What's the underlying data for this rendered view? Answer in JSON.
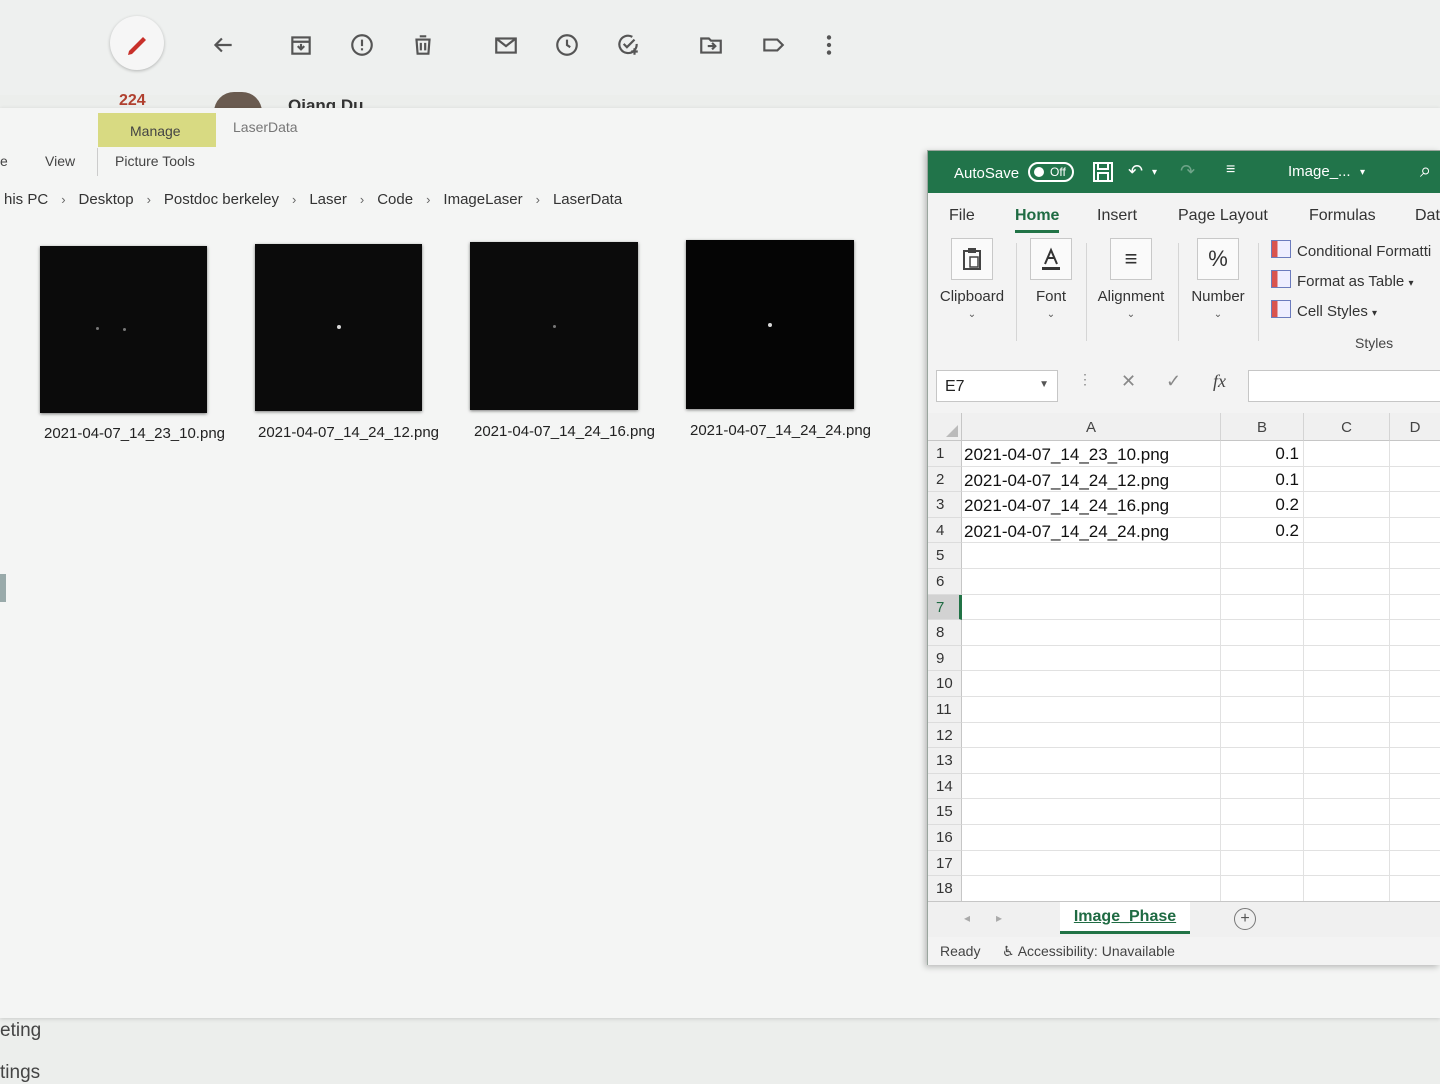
{
  "gmail": {
    "inbox_count": "224",
    "sender": "Qiang Du",
    "left_items": [
      "eting",
      "tings"
    ]
  },
  "explorer": {
    "context_tab": "Manage",
    "window_title": "LaserData",
    "ribbon_left": "e",
    "view_tab": "View",
    "picture_tools": "Picture Tools",
    "breadcrumb": [
      "his PC",
      "Desktop",
      "Postdoc berkeley",
      "Laser",
      "Code",
      "ImageLaser",
      "LaserData"
    ],
    "files": [
      "2021-04-07_14_23_10.png",
      "2021-04-07_14_24_12.png",
      "2021-04-07_14_24_16.png",
      "2021-04-07_14_24_24.png"
    ]
  },
  "excel": {
    "autosave_label": "AutoSave",
    "autosave_state": "Off",
    "doc_title": "Image_...",
    "tabs": [
      "File",
      "Home",
      "Insert",
      "Page Layout",
      "Formulas",
      "Dat"
    ],
    "active_tab": "Home",
    "groups": {
      "clipboard": "Clipboard",
      "font": "Font",
      "alignment": "Alignment",
      "number": "Number",
      "number_symbol": "%",
      "styles": "Styles"
    },
    "styles_items": [
      "Conditional Formatti",
      "Format as Table",
      "Cell Styles"
    ],
    "name_box": "E7",
    "fx": "fx",
    "columns": [
      "A",
      "B",
      "C",
      "D"
    ],
    "row_numbers": [
      "1",
      "2",
      "3",
      "4",
      "5",
      "6",
      "7",
      "8",
      "9",
      "10",
      "11",
      "12",
      "13",
      "14",
      "15",
      "16",
      "17",
      "18"
    ],
    "selected_row": "7",
    "cells": [
      {
        "a": "2021-04-07_14_23_10.png",
        "b": "0.1"
      },
      {
        "a": "2021-04-07_14_24_12.png",
        "b": "0.1"
      },
      {
        "a": "2021-04-07_14_24_16.png",
        "b": "0.2"
      },
      {
        "a": "2021-04-07_14_24_24.png",
        "b": "0.2"
      }
    ],
    "sheet_tab": "Image_Phase",
    "status_ready": "Ready",
    "status_accessibility": "Accessibility: Unavailable"
  }
}
